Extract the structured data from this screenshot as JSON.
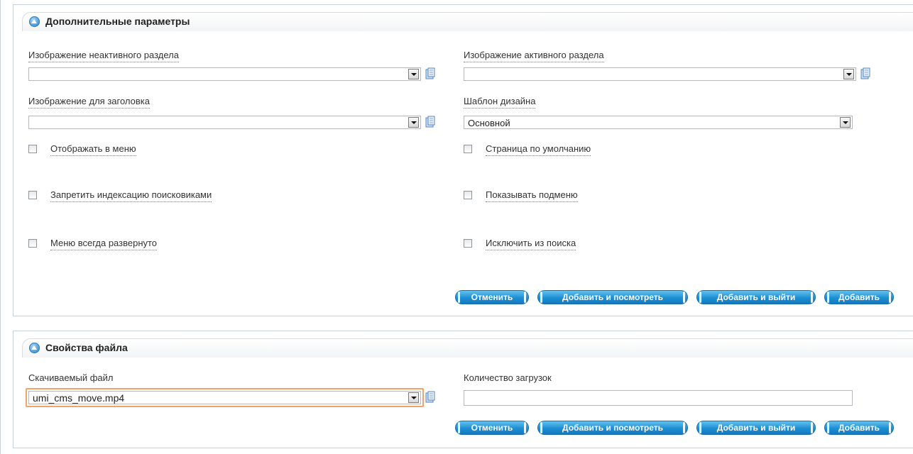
{
  "panel1": {
    "title": "Дополнительные параметры",
    "inactive_image_label": "Изображение неактивного раздела",
    "active_image_label": "Изображение активного раздела",
    "header_image_label": "Изображение для заголовка",
    "design_template_label": "Шаблон дизайна",
    "design_template_value": "Основной",
    "checkboxes": [
      {
        "label": "Отображать в меню",
        "checked": false
      },
      {
        "label": "Страница по умолчанию",
        "checked": false
      },
      {
        "label": "Запретить индексацию поисковиками",
        "checked": false
      },
      {
        "label": "Показывать подменю",
        "checked": false
      },
      {
        "label": "Меню всегда развернуто",
        "checked": false
      },
      {
        "label": "Исключить из поиска",
        "checked": false
      }
    ],
    "buttons": {
      "cancel": "Отменить",
      "add_view": "Добавить и посмотреть",
      "add_exit": "Добавить и выйти",
      "add": "Добавить"
    }
  },
  "panel2": {
    "title": "Свойства файла",
    "file_label": "Скачиваемый файл",
    "file_value": "umi_cms_move.mp4",
    "downloads_label": "Количество загрузок",
    "downloads_value": "",
    "buttons": {
      "cancel": "Отменить",
      "add_view": "Добавить и посмотреть",
      "add_exit": "Добавить и выйти",
      "add": "Добавить"
    }
  },
  "colors": {
    "button_blue": "#1d8fd2",
    "highlight_orange": "#f3a36a",
    "panel_border": "#c6d1da"
  }
}
